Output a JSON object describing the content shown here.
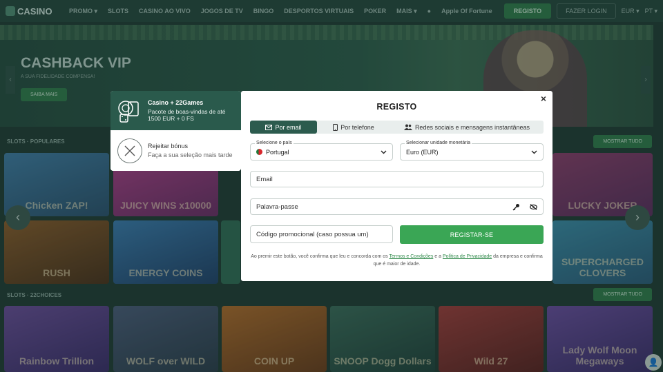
{
  "site": {
    "logo": "CASINO",
    "nav": [
      "PROMO ▾",
      "SLOTS",
      "CASINO AO VIVO",
      "JOGOS DE TV",
      "BINGO",
      "DESPORTOS VIRTUAIS",
      "POKER",
      "MAIS ▾"
    ],
    "app_label": "Apple Of Fortune",
    "register_label": "REGISTO",
    "login_label": "FAZER LOGIN",
    "currency": "EUR ▾",
    "language": "PT ▾"
  },
  "banner": {
    "title": "CASHBACK VIP",
    "subtitle": "A SUA FIDELIDADE COMPENSA!",
    "button": "SAIBA MAIS"
  },
  "sections": [
    {
      "title": "SLOTS · POPULARES",
      "button": "MOSTRAR TUDO"
    },
    {
      "title": "SLOTS · 22CHOICES",
      "button": "MOSTRAR TUDO"
    }
  ],
  "games_row1": [
    "Chicken ZAP!",
    "JUICY WINS x10000",
    "",
    "",
    "",
    "LUCKY JOKER"
  ],
  "games_row2": [
    "RUSH",
    "ENERGY COINS",
    "",
    "",
    "",
    "SUPERCHARGED CLOVERS"
  ],
  "games_row3": [
    "Rainbow Trillion",
    "WOLF over WILD",
    "COIN UP",
    "SNOOP Dogg Dollars",
    "Wild 27",
    "Lady Wolf Moon Megaways"
  ],
  "bonus": {
    "title": "Casino + 22Games",
    "description": "Pacote de boas-vindas de até 1500 EUR + 0 FS",
    "reject_title": "Rejeitar bónus",
    "reject_description": "Faça a sua seleção mais tarde"
  },
  "modal": {
    "title": "REGISTO",
    "close": "×",
    "tabs": [
      {
        "label": "Por email",
        "icon": "envelope-icon",
        "active": true
      },
      {
        "label": "Por telefone",
        "icon": "phone-icon",
        "active": false
      },
      {
        "label": "Redes sociais e mensagens instantâneas",
        "icon": "people-icon",
        "active": false
      }
    ],
    "country": {
      "label": "Selecione o país",
      "value": "Portugal"
    },
    "currency": {
      "label": "Selecionar unidade monetária",
      "value": "Euro (EUR)"
    },
    "email_placeholder": "Email",
    "password_placeholder": "Palavra-passe",
    "promo_placeholder": "Código promocional (caso possua um)",
    "submit": "REGISTAR-SE",
    "legal": {
      "prefix": "Ao premir este botão, você confirma que leu e concorda com os",
      "terms": "Termos e Condições",
      "and": "e a",
      "privacy": "Política de Privacidade",
      "suffix": "da empresa e confirma que é maior de idade."
    }
  },
  "colors": {
    "accent_green": "#3aa655",
    "tab_active": "#2c5b4e",
    "bonus_panel": "#2a5a4c"
  }
}
